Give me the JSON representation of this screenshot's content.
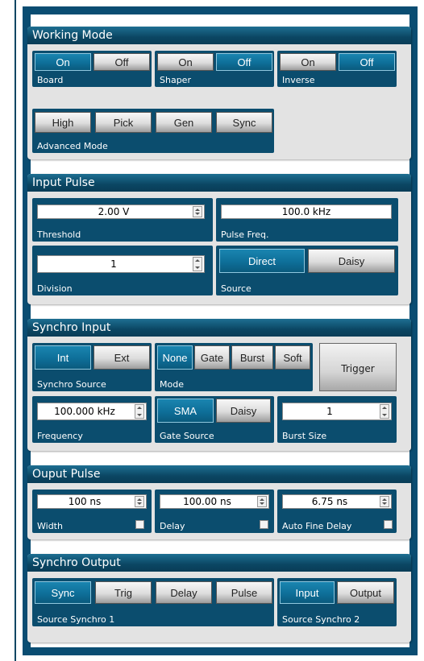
{
  "working_mode": {
    "title": "Working Mode",
    "board": {
      "label": "Board",
      "on": "On",
      "off": "Off",
      "state": "on"
    },
    "shaper": {
      "label": "Shaper",
      "on": "On",
      "off": "Off",
      "state": "off"
    },
    "inverse": {
      "label": "Inverse",
      "on": "On",
      "off": "Off",
      "state": "off"
    },
    "advanced": {
      "label": "Advanced Mode",
      "buttons": [
        "High",
        "Pick",
        "Gen",
        "Sync"
      ]
    }
  },
  "input_pulse": {
    "title": "Input Pulse",
    "threshold": {
      "label": "Threshold",
      "value": "2.00 V"
    },
    "pulse_freq": {
      "label": "Pulse Freq.",
      "value": "100.0 kHz"
    },
    "division": {
      "label": "Division",
      "value": "1"
    },
    "source": {
      "label": "Source",
      "options": [
        "Direct",
        "Daisy"
      ],
      "selected": "Direct"
    }
  },
  "synchro_input": {
    "title": "Synchro Input",
    "synchro_source": {
      "label": "Synchro Source",
      "options": [
        "Int",
        "Ext"
      ],
      "selected": "Int"
    },
    "mode": {
      "label": "Mode",
      "options": [
        "None",
        "Gate",
        "Burst",
        "Soft"
      ],
      "selected": "None"
    },
    "trigger_label": "Trigger",
    "frequency": {
      "label": "Frequency",
      "value": "100.000 kHz"
    },
    "gate_source": {
      "label": "Gate Source",
      "options": [
        "SMA",
        "Daisy"
      ],
      "selected": "SMA"
    },
    "burst_size": {
      "label": "Burst Size",
      "value": "1"
    }
  },
  "output_pulse": {
    "title": "Ouput Pulse",
    "width": {
      "label": "Width",
      "value": "100 ns"
    },
    "delay": {
      "label": "Delay",
      "value": "100.00 ns"
    },
    "auto_fine_delay": {
      "label": "Auto Fine Delay",
      "value": "6.75 ns"
    }
  },
  "synchro_output": {
    "title": "Synchro Output",
    "source1": {
      "label": "Source Synchro 1",
      "options": [
        "Sync",
        "Trig",
        "Delay",
        "Pulse"
      ],
      "selected": "Sync"
    },
    "source2": {
      "label": "Source Synchro 2",
      "options": [
        "Input",
        "Output"
      ],
      "selected": "Input"
    }
  },
  "colors": {
    "accent": "#0e6f99",
    "frame": "#0a4d72",
    "panel": "#e3e3e3"
  }
}
